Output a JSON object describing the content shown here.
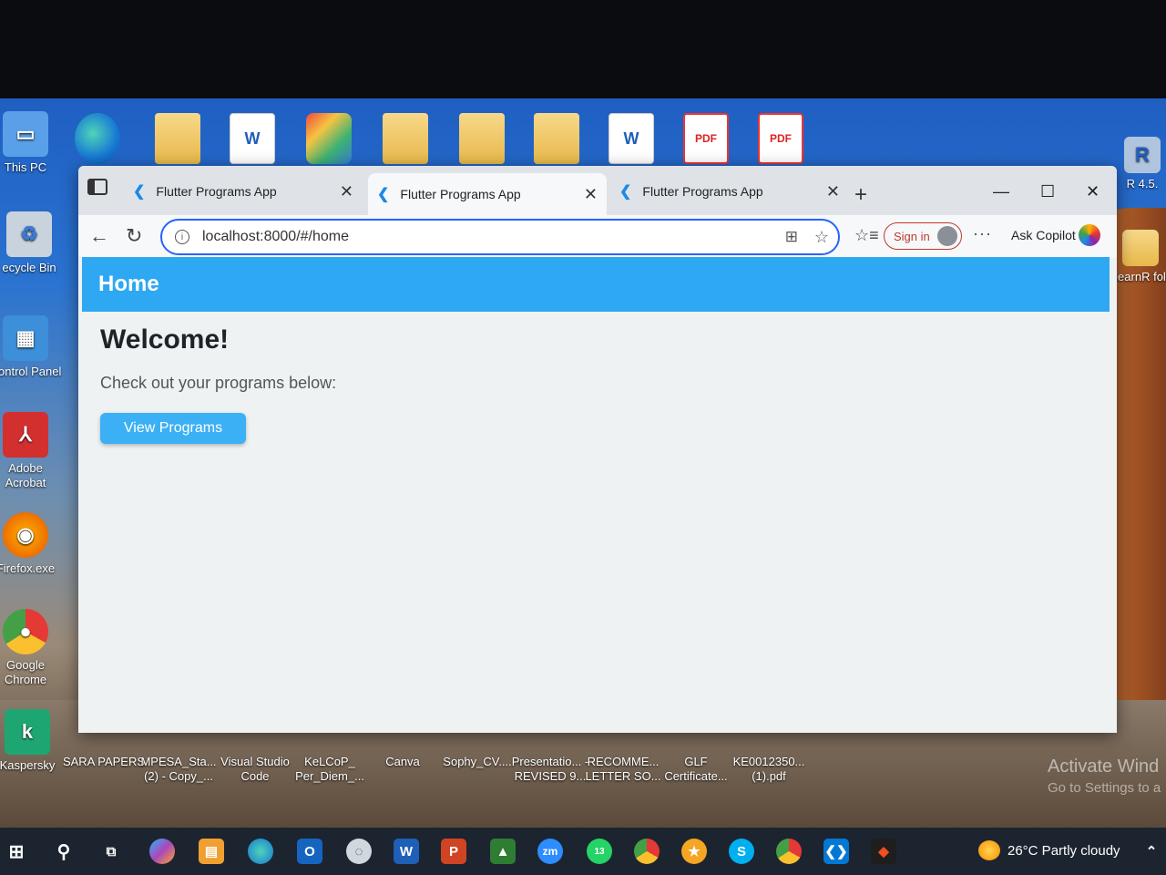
{
  "desktop": {
    "left_icons": [
      {
        "label": "This PC",
        "icon": "monitor-icon"
      },
      {
        "label": "ecycle Bin",
        "icon": "recycle-bin-icon"
      },
      {
        "label": "Control Panel",
        "icon": "control-panel-icon"
      },
      {
        "label": "Adobe Acrobat",
        "icon": "adobe-acrobat-icon"
      },
      {
        "label": "Firefox.exe",
        "icon": "firefox-icon"
      },
      {
        "label": "Google Chrome",
        "icon": "chrome-icon"
      },
      {
        "label": "Kaspersky",
        "icon": "kaspersky-icon"
      }
    ],
    "right_icons": [
      {
        "label": "R 4.5.",
        "icon": "r-icon"
      },
      {
        "label": "learnR fol",
        "icon": "folder-icon"
      }
    ],
    "bottom_icons": [
      {
        "label": "SARA PAPERS"
      },
      {
        "label": "MPESA_Sta... (2) - Copy_..."
      },
      {
        "label": "Visual Studio Code"
      },
      {
        "label": "KeLCoP_ Per_Diem_..."
      },
      {
        "label": "Canva"
      },
      {
        "label": "Sophy_CV...."
      },
      {
        "label": "Presentatio... - REVISED 9..."
      },
      {
        "label": "RECOMME... LETTER SO..."
      },
      {
        "label": "GLF Certificate..."
      },
      {
        "label": "KE0012350... (1).pdf"
      }
    ],
    "watermark": {
      "line1": "Activate Wind",
      "line2": "Go to Settings to a"
    },
    "pdf_badge": "PDF",
    "word_badge": "W"
  },
  "browser": {
    "tabs": [
      {
        "title": "Flutter Programs App",
        "active": false
      },
      {
        "title": "Flutter Programs App",
        "active": true
      },
      {
        "title": "Flutter Programs App",
        "active": false
      }
    ],
    "address": "localhost:8000/#/home",
    "signin_label": "Sign in",
    "copilot_label": "Ask Copilot",
    "more_label": "···"
  },
  "app": {
    "appbar_title": "Home",
    "heading": "Welcome!",
    "subtitle": "Check out your programs below:",
    "button_label": "View Programs",
    "accent": "#2fa8f3"
  },
  "taskbar": {
    "weather": "26°C  Partly cloudy",
    "whatsapp_badge": "13",
    "zoom_label": "zm"
  }
}
